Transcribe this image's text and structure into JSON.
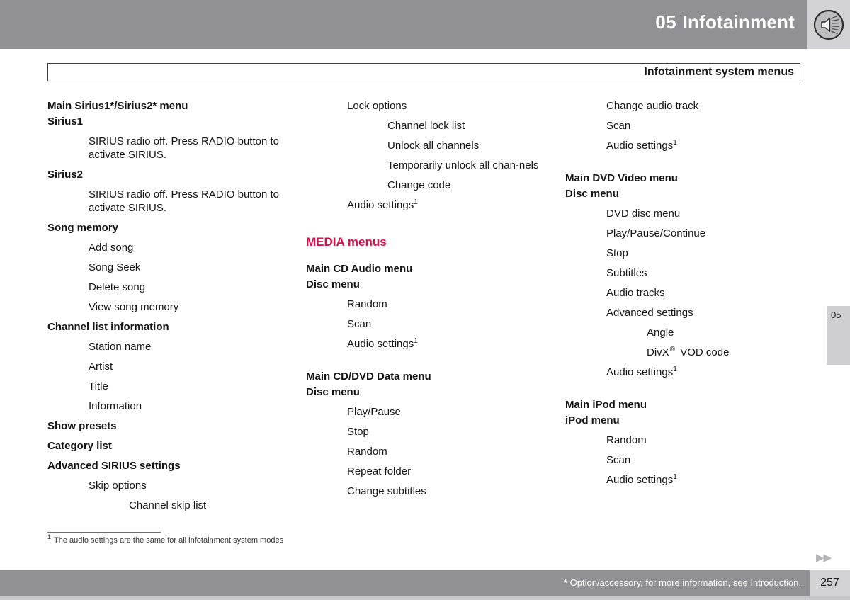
{
  "header": {
    "chapter_number": "05",
    "chapter_title": "Infotainment",
    "icon": "speaker-sound-icon"
  },
  "title_box": {
    "text": "Infotainment system menus"
  },
  "columns": {
    "col1": [
      {
        "level": 0,
        "style": "bold",
        "text": "Main Sirius1*/Sirius2* menu"
      },
      {
        "level": 0,
        "style": "sub-bold",
        "text": "Sirius1"
      },
      {
        "level": 1,
        "style": "normal",
        "text": "SIRIUS radio off. Press RADIO button to activate SIRIUS."
      },
      {
        "level": 0,
        "style": "sub-bold",
        "text": "Sirius2"
      },
      {
        "level": 1,
        "style": "normal",
        "text": "SIRIUS radio off. Press RADIO button to activate SIRIUS."
      },
      {
        "level": 0,
        "style": "sub-bold",
        "text": "Song memory"
      },
      {
        "level": 1,
        "style": "normal",
        "text": "Add song"
      },
      {
        "level": 1,
        "style": "normal",
        "text": "Song Seek"
      },
      {
        "level": 1,
        "style": "normal",
        "text": "Delete song"
      },
      {
        "level": 1,
        "style": "normal",
        "text": "View song memory"
      },
      {
        "level": 0,
        "style": "sub-bold",
        "text": "Channel list information"
      },
      {
        "level": 1,
        "style": "normal",
        "text": "Station name"
      },
      {
        "level": 1,
        "style": "normal",
        "text": "Artist"
      },
      {
        "level": 1,
        "style": "normal",
        "text": "Title"
      },
      {
        "level": 1,
        "style": "normal",
        "text": "Information"
      },
      {
        "level": 0,
        "style": "sub-bold",
        "text": "Show presets"
      },
      {
        "level": 0,
        "style": "sub-bold",
        "text": "Category list"
      },
      {
        "level": 0,
        "style": "sub-bold",
        "text": "Advanced SIRIUS settings"
      },
      {
        "level": 1,
        "style": "normal",
        "text": "Skip options"
      },
      {
        "level": 2,
        "style": "normal",
        "text": "Channel skip list"
      }
    ],
    "col2_top": [
      {
        "level": 1,
        "style": "normal",
        "text": "Lock options"
      },
      {
        "level": 2,
        "style": "normal",
        "text": "Channel lock list"
      },
      {
        "level": 2,
        "style": "normal",
        "text": "Unlock all channels"
      },
      {
        "level": 2,
        "style": "normal",
        "text": "Temporarily unlock all chan-⁠nels"
      },
      {
        "level": 2,
        "style": "normal",
        "text": "Change code"
      },
      {
        "level": 1,
        "style": "footnoted",
        "text": "Audio settings",
        "footnote": "1"
      }
    ],
    "media_section_heading": "MEDIA menus",
    "col2_groups": [
      {
        "title": "Main CD Audio menu",
        "subtitle": "Disc menu",
        "items": [
          {
            "level": 1,
            "style": "normal",
            "text": "Random"
          },
          {
            "level": 1,
            "style": "normal",
            "text": "Scan"
          },
          {
            "level": 1,
            "style": "footnoted",
            "text": "Audio settings",
            "footnote": "1"
          }
        ]
      },
      {
        "title": "Main CD/DVD Data menu",
        "subtitle": "Disc menu",
        "items": [
          {
            "level": 1,
            "style": "normal",
            "text": "Play/Pause"
          },
          {
            "level": 1,
            "style": "normal",
            "text": "Stop"
          },
          {
            "level": 1,
            "style": "normal",
            "text": "Random"
          },
          {
            "level": 1,
            "style": "normal",
            "text": "Repeat folder"
          },
          {
            "level": 1,
            "style": "normal",
            "text": "Change subtitles"
          }
        ]
      }
    ],
    "col3_top": [
      {
        "level": 1,
        "style": "normal",
        "text": "Change audio track"
      },
      {
        "level": 1,
        "style": "normal",
        "text": "Scan"
      },
      {
        "level": 1,
        "style": "footnoted",
        "text": "Audio settings",
        "footnote": "1"
      }
    ],
    "col3_groups": [
      {
        "title": "Main DVD Video menu",
        "subtitle": "Disc menu",
        "items": [
          {
            "level": 1,
            "style": "normal",
            "text": "DVD disc menu"
          },
          {
            "level": 1,
            "style": "normal",
            "text": "Play/Pause/Continue"
          },
          {
            "level": 1,
            "style": "normal",
            "text": "Stop"
          },
          {
            "level": 1,
            "style": "normal",
            "text": "Subtitles"
          },
          {
            "level": 1,
            "style": "normal",
            "text": "Audio tracks"
          },
          {
            "level": 1,
            "style": "normal",
            "text": "Advanced settings"
          },
          {
            "level": 2,
            "style": "normal",
            "text": "Angle"
          },
          {
            "level": 2,
            "style": "registered",
            "text_before": "DivX",
            "text_after": "VOD code"
          },
          {
            "level": 1,
            "style": "footnoted",
            "text": "Audio settings",
            "footnote": "1"
          }
        ]
      },
      {
        "title": "Main iPod menu",
        "subtitle": "iPod menu",
        "items": [
          {
            "level": 1,
            "style": "normal",
            "text": "Random"
          },
          {
            "level": 1,
            "style": "normal",
            "text": "Scan"
          },
          {
            "level": 1,
            "style": "footnoted",
            "text": "Audio settings",
            "footnote": "1"
          }
        ]
      }
    ]
  },
  "footnote": {
    "marker": "1",
    "text": "The audio settings are the same for all infotainment system modes"
  },
  "side_tab": {
    "label": "05"
  },
  "page_arrows": {
    "glyph": "▶▶"
  },
  "footer": {
    "star": "*",
    "note": "Option/accessory, for more information, see Introduction.",
    "page_number": "257"
  },
  "colors": {
    "header_bar": "#919195",
    "header_icon_panel": "#d3d3d5",
    "media_heading": "#d6104a",
    "text": "#141414",
    "side_tab": "#cfcfd1"
  }
}
